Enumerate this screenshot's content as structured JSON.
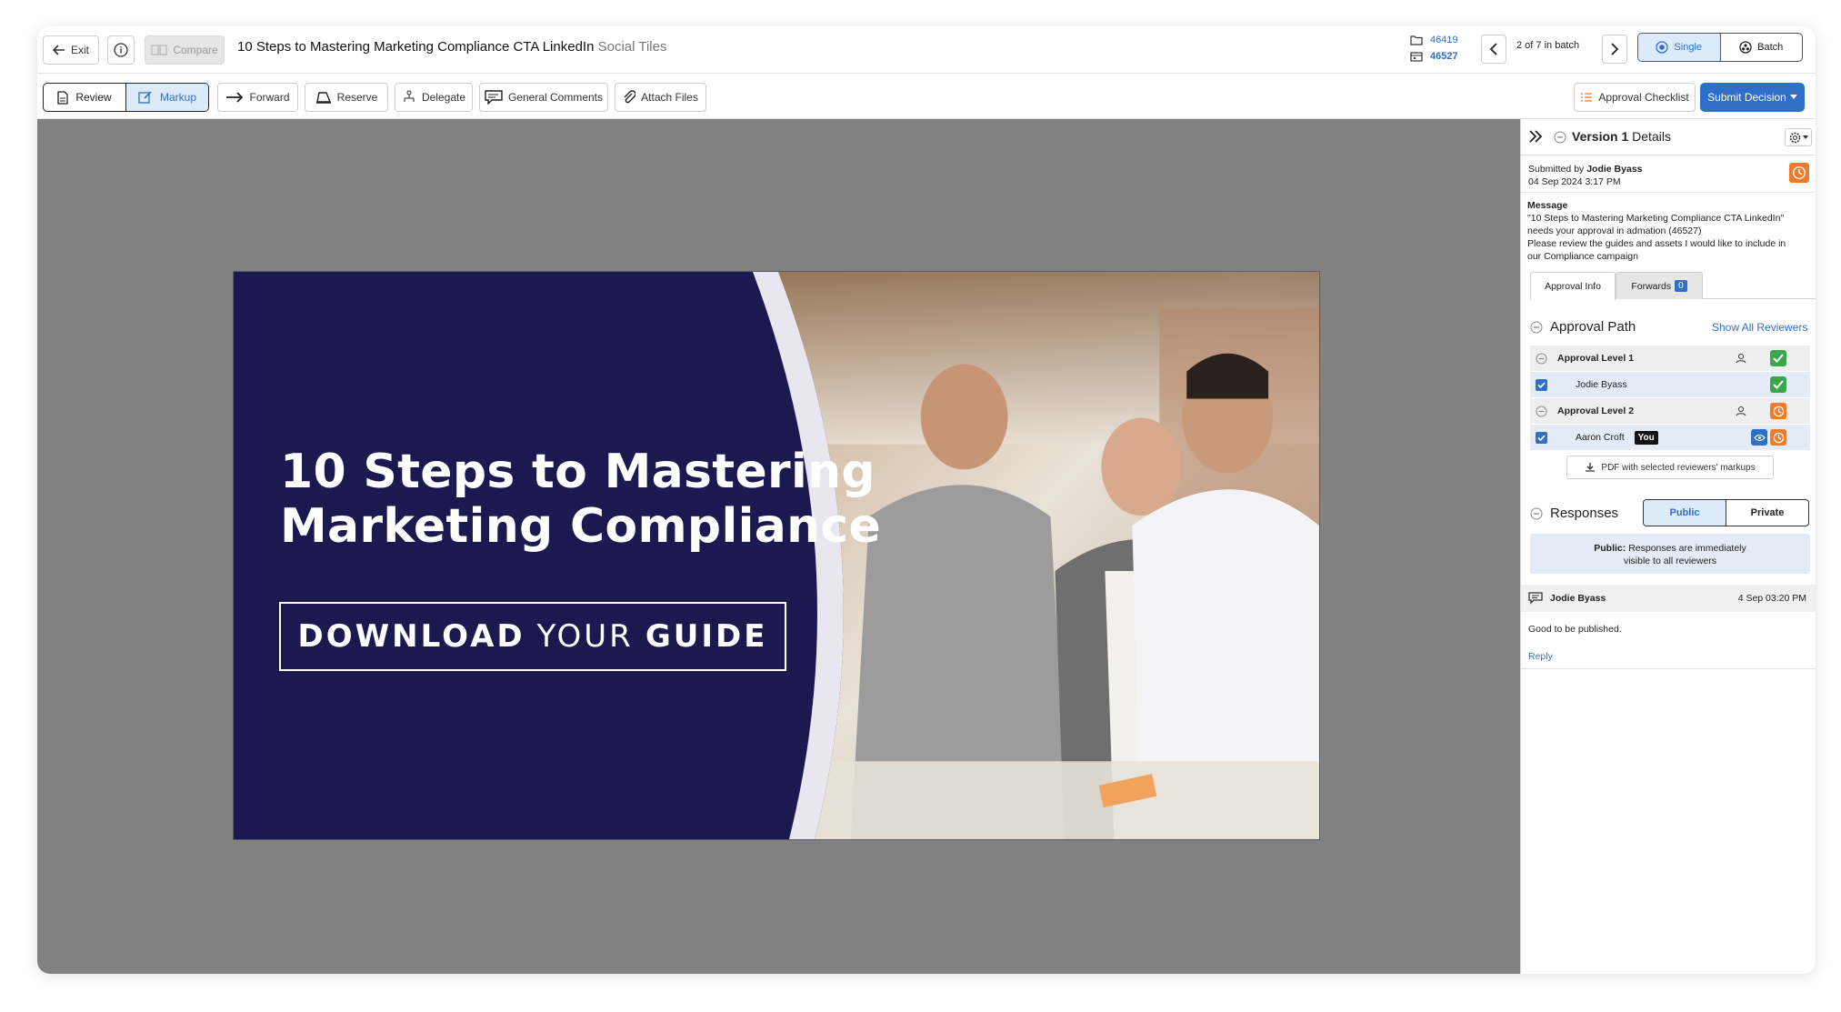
{
  "topbar": {
    "exit_label": "Exit",
    "compare_label": "Compare",
    "title": "10 Steps to Mastering Marketing Compliance CTA LinkedIn",
    "subtitle": "Social Tiles",
    "folder_id": "46419",
    "item_id": "46527",
    "batch_position": "2 of 7 in batch",
    "view_single": "Single",
    "view_batch": "Batch"
  },
  "toolbar": {
    "review_label": "Review",
    "markup_label": "Markup",
    "forward_label": "Forward",
    "reserve_label": "Reserve",
    "delegate_label": "Delegate",
    "general_comments_label": "General Comments",
    "attach_files_label": "Attach Files",
    "approval_checklist_label": "Approval Checklist",
    "submit_label": "Submit Decision"
  },
  "banner": {
    "headline_line1": "10 Steps to Mastering",
    "headline_line2": "Marketing Compliance",
    "cta_word1": "DOWNLOAD",
    "cta_word2": "YOUR",
    "cta_word3": "GUIDE",
    "background_color": "#1c1850"
  },
  "panel": {
    "version_label": "Version 1",
    "details_label": "Details",
    "submitted_by_prefix": "Submitted by",
    "submitted_by": "Jodie Byass",
    "submitted_date": "04 Sep 2024 3:17 PM",
    "message_label": "Message",
    "message_line1": "\"10 Steps to Mastering Marketing Compliance CTA LinkedIn\"",
    "message_line2": "needs your approval in admation (46527)",
    "message_line3": "Please review the guides and assets I would like to include in",
    "message_line4": "our Compliance campaign",
    "tab_approval_info": "Approval Info",
    "tab_forwards": "Forwards",
    "forwards_count": "0",
    "approval_path_label": "Approval Path",
    "show_all_reviewers": "Show All Reviewers",
    "levels": [
      {
        "label": "Approval Level 1",
        "reviewer": "Jodie Byass",
        "status": "approved"
      },
      {
        "label": "Approval Level 2",
        "reviewer": "Aaron Croft",
        "status": "pending"
      }
    ],
    "you_badge": "You",
    "pdf_button": "PDF with selected reviewers' markups",
    "responses_label": "Responses",
    "public_label": "Public",
    "private_label": "Private",
    "public_note_bold": "Public:",
    "public_note_line1": "Responses are immediately",
    "public_note_line2": "visible to all reviewers",
    "comment": {
      "author": "Jodie Byass",
      "timestamp": "4 Sep 03:20 PM",
      "text": "Good to be published.",
      "reply_label": "Reply"
    }
  },
  "colors": {
    "accent": "#2f6fc9",
    "approved": "#3aa84a",
    "pending": "#ee7a2b",
    "canvas": "#818181"
  }
}
